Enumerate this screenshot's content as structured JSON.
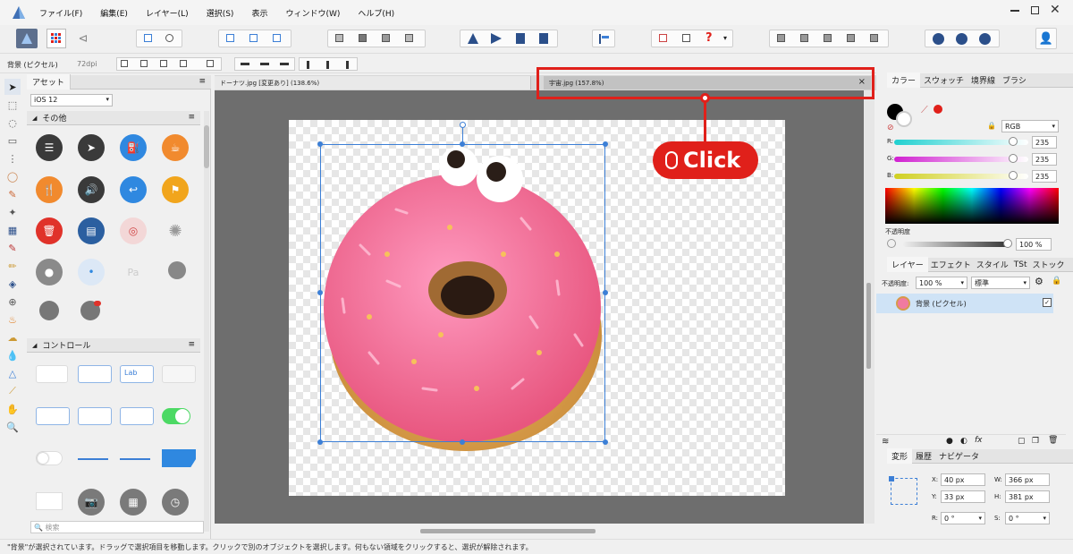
{
  "menu": [
    "ファイル(F)",
    "編集(E)",
    "レイヤー(L)",
    "選択(S)",
    "表示",
    "ウィンドウ(W)",
    "ヘルプ(H)"
  ],
  "context": {
    "layer_label": "背景 (ピクセル)",
    "dpi": "72dpi"
  },
  "tabs": [
    {
      "label": "ドーナツ.jpg [変更あり] (138.6%)"
    },
    {
      "label": "宇宙.jpg (157.8%)"
    }
  ],
  "close_glyph": "×",
  "assets": {
    "title": "アセット",
    "set_name": "iOS 12",
    "section_other": "その他",
    "section_controls": "コントロール",
    "search_placeholder": "検索",
    "lab_text": "Lab"
  },
  "annotation": {
    "label": "Click"
  },
  "color_panel": {
    "tabs": [
      "カラー",
      "スウォッチ",
      "境界線",
      "ブラシ"
    ],
    "mode": "RGB",
    "r_label": "R:",
    "g_label": "G:",
    "b_label": "B:",
    "r": "235",
    "g": "235",
    "b": "235",
    "opacity_label": "不透明度",
    "opacity": "100 %"
  },
  "layers_panel": {
    "tabs": [
      "レイヤー",
      "エフェクト",
      "スタイル",
      "TSt",
      "ストック"
    ],
    "opacity_label": "不透明度:",
    "opacity": "100 %",
    "blend": "標準",
    "layer_name": "背景 (ピクセル)"
  },
  "transform_panel": {
    "tabs": [
      "変形",
      "履歴",
      "ナビゲータ"
    ],
    "x_label": "X:",
    "x": "40 px",
    "y_label": "Y:",
    "y": "33 px",
    "w_label": "W:",
    "w": "366 px",
    "h_label": "H:",
    "h": "381 px",
    "r_label": "R:",
    "r": "0 °",
    "s_label": "S:",
    "s": "0 °"
  },
  "status": "\"背景\"が選択されています。ドラッグで選択項目を移動します。クリックで別のオブジェクトを選択します。何もない領域をクリックすると、選択が解除されます。",
  "colors": {
    "accent": "#e0201a",
    "selection": "#3c7fd6",
    "canvas_bg": "#6e6e6e"
  }
}
